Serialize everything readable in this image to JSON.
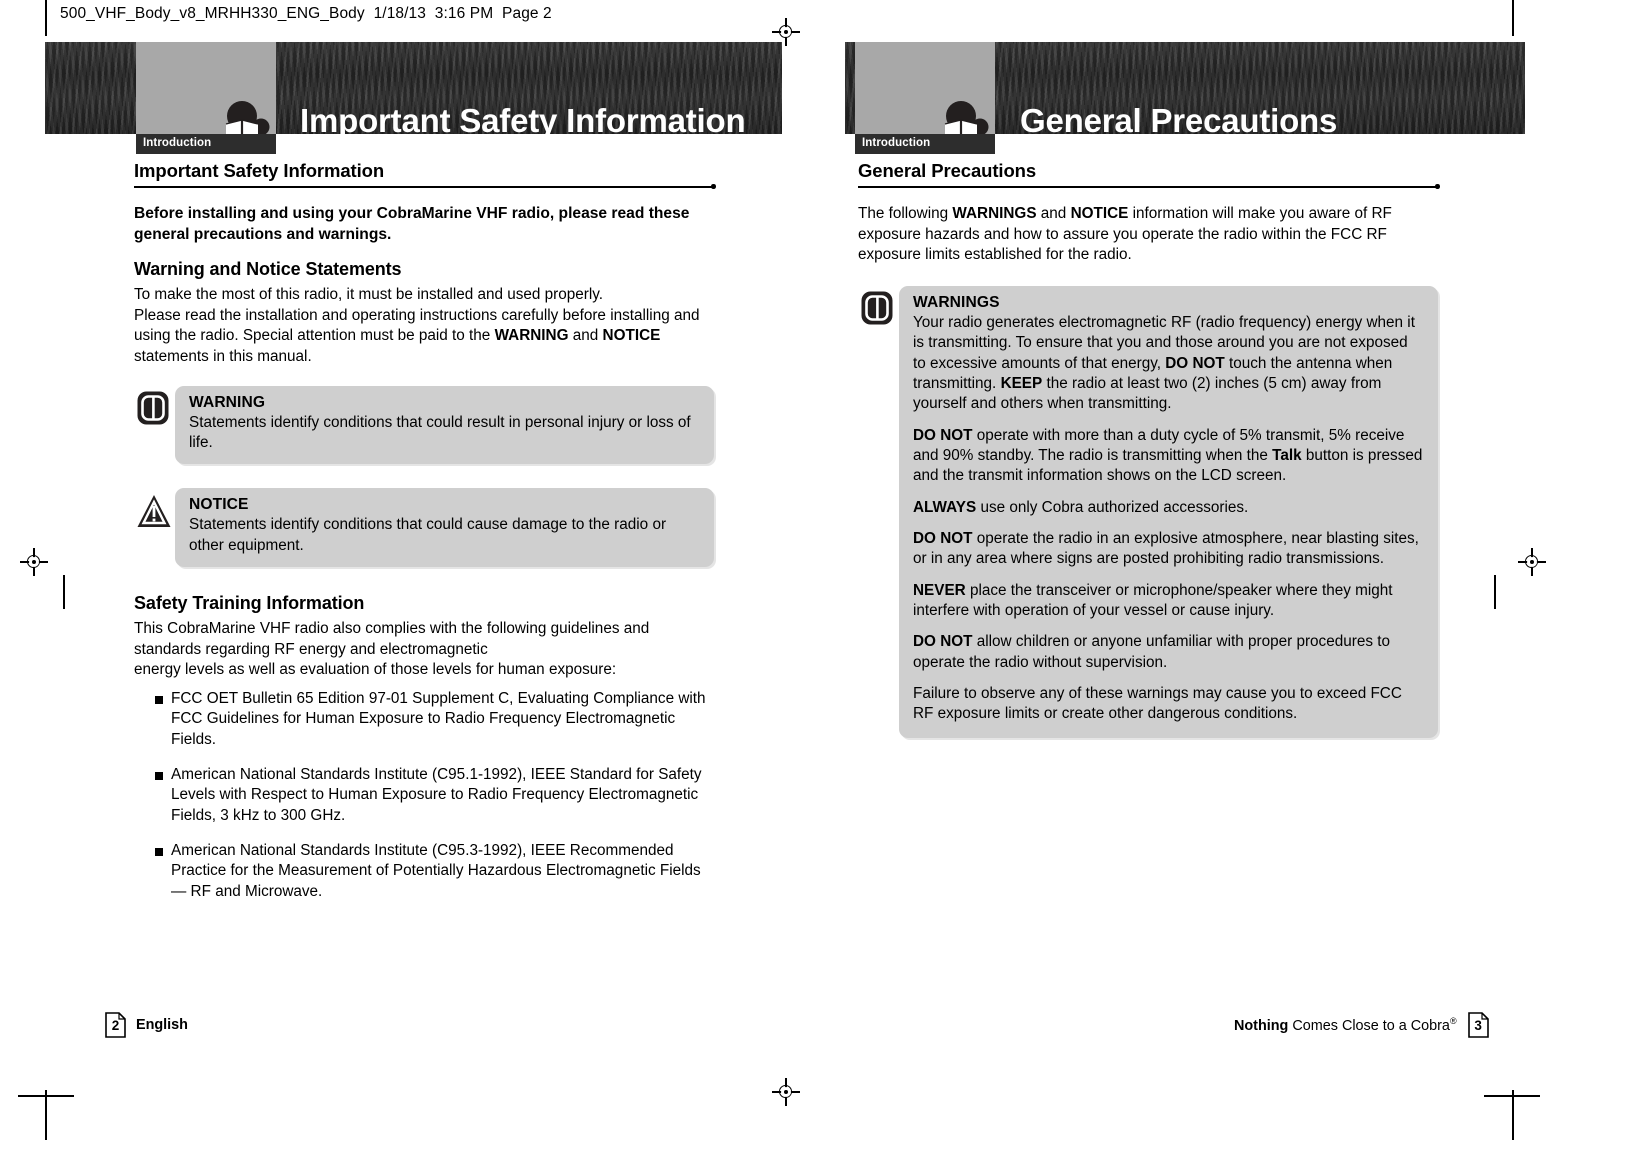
{
  "print_header": "500_VHF_Body_v8_MRHH330_ENG_Body  1/18/13  3:16 PM  Page 2",
  "left_page": {
    "banner_title": "Important Safety Information",
    "tab_label": "Introduction",
    "section_heading": "Important Safety Information",
    "lead": "Before installing and using your CobraMarine VHF radio, please read these general precautions and warnings.",
    "subhead_1": "Warning and Notice Statements",
    "para_1_a": "To make the most of this radio, it must be installed and used properly.",
    "para_1_b": "Please read the installation and operating instructions carefully before installing and using the radio. Special attention must be paid to the ",
    "para_1_bold_1": "WARNING",
    "para_1_c": " and ",
    "para_1_bold_2": "NOTICE",
    "para_1_d": " statements in this manual.",
    "warning_box": {
      "icon": "warning-badge-icon",
      "title": "WARNING",
      "text": "Statements identify conditions that could result in personal injury or loss of life."
    },
    "notice_box": {
      "icon": "notice-triangle-icon",
      "title": "NOTICE",
      "text": "Statements identify conditions that could cause damage to the radio or other equipment."
    },
    "subhead_2": "Safety Training Information",
    "para_2_a": "This CobraMarine VHF radio also complies with the following guidelines and standards regarding RF energy and electromagnetic",
    "para_2_b": "energy levels as well as evaluation of those levels for human exposure:",
    "bullets": [
      "FCC OET Bulletin 65 Edition 97-01 Supplement C, Evaluating Compliance with FCC Guidelines for Human Exposure to Radio Frequency Electromagnetic Fields.",
      "American National Standards Institute (C95.1-1992), IEEE Standard for Safety Levels with Respect to Human Exposure to Radio Frequency Electromagnetic Fields, 3 kHz to 300 GHz.",
      "American National Standards Institute (C95.3-1992), IEEE Recommended Practice for the Measurement of Potentially Hazardous Electromagnetic Fields — RF and Microwave."
    ],
    "footer": {
      "page_number": "2",
      "label": "English"
    }
  },
  "right_page": {
    "banner_title": "General Precautions",
    "tab_label": "Introduction",
    "section_heading": "General Precautions",
    "intro_a": "The following ",
    "intro_bold_1": "WARNINGS",
    "intro_b": " and ",
    "intro_bold_2": "NOTICE",
    "intro_c": " information will make you aware of RF exposure hazards and how to assure you operate the radio within the FCC RF exposure limits established for the radio.",
    "warnings_box": {
      "icon": "warning-badge-icon",
      "title": "WARNINGS",
      "paragraphs": [
        {
          "segments": [
            {
              "text": "Your radio generates electromagnetic RF (radio frequency) energy when it is transmitting. To ensure that you and those around you are not exposed to excessive amounts of that energy, ",
              "bold": false
            },
            {
              "text": "DO NOT",
              "bold": true
            },
            {
              "text": " touch the antenna when transmitting. ",
              "bold": false
            },
            {
              "text": "KEEP",
              "bold": true
            },
            {
              "text": " the radio at least two (2) inches (5 cm) away from yourself and others when transmitting.",
              "bold": false
            }
          ]
        },
        {
          "segments": [
            {
              "text": "DO NOT",
              "bold": true
            },
            {
              "text": " operate with more than a duty cycle of 5% transmit, 5% receive and 90% standby. The radio is transmitting when the ",
              "bold": false
            },
            {
              "text": "Talk",
              "bold": true
            },
            {
              "text": " button is pressed and the transmit information shows on the LCD screen.",
              "bold": false
            }
          ]
        },
        {
          "segments": [
            {
              "text": "ALWAYS",
              "bold": true
            },
            {
              "text": " use only Cobra authorized accessories.",
              "bold": false
            }
          ]
        },
        {
          "segments": [
            {
              "text": "DO NOT",
              "bold": true
            },
            {
              "text": " operate the radio in an explosive atmosphere, near blasting sites, or in any area where signs are posted prohibiting radio transmissions.",
              "bold": false
            }
          ]
        },
        {
          "segments": [
            {
              "text": "NEVER",
              "bold": true
            },
            {
              "text": " place the transceiver or microphone/speaker where they might interfere with operation of your vessel or cause injury.",
              "bold": false
            }
          ]
        },
        {
          "segments": [
            {
              "text": "DO NOT",
              "bold": true
            },
            {
              "text": " allow children or anyone unfamiliar with proper procedures to operate the radio without supervision.",
              "bold": false
            }
          ]
        },
        {
          "segments": [
            {
              "text": "Failure to observe any of these warnings may cause you to exceed FCC RF exposure limits or create other dangerous conditions.",
              "bold": false
            }
          ]
        }
      ]
    },
    "footer": {
      "tagline_bold": "Nothing",
      "tagline_rest": " Comes Close to a Cobra",
      "tagline_mark": "®",
      "page_number": "3"
    }
  },
  "colors": {
    "banner_dark": "#2d2d2d",
    "tab_gray": "#a8a8a8",
    "callout_gray": "#cfcfcf",
    "text": "#000000"
  }
}
